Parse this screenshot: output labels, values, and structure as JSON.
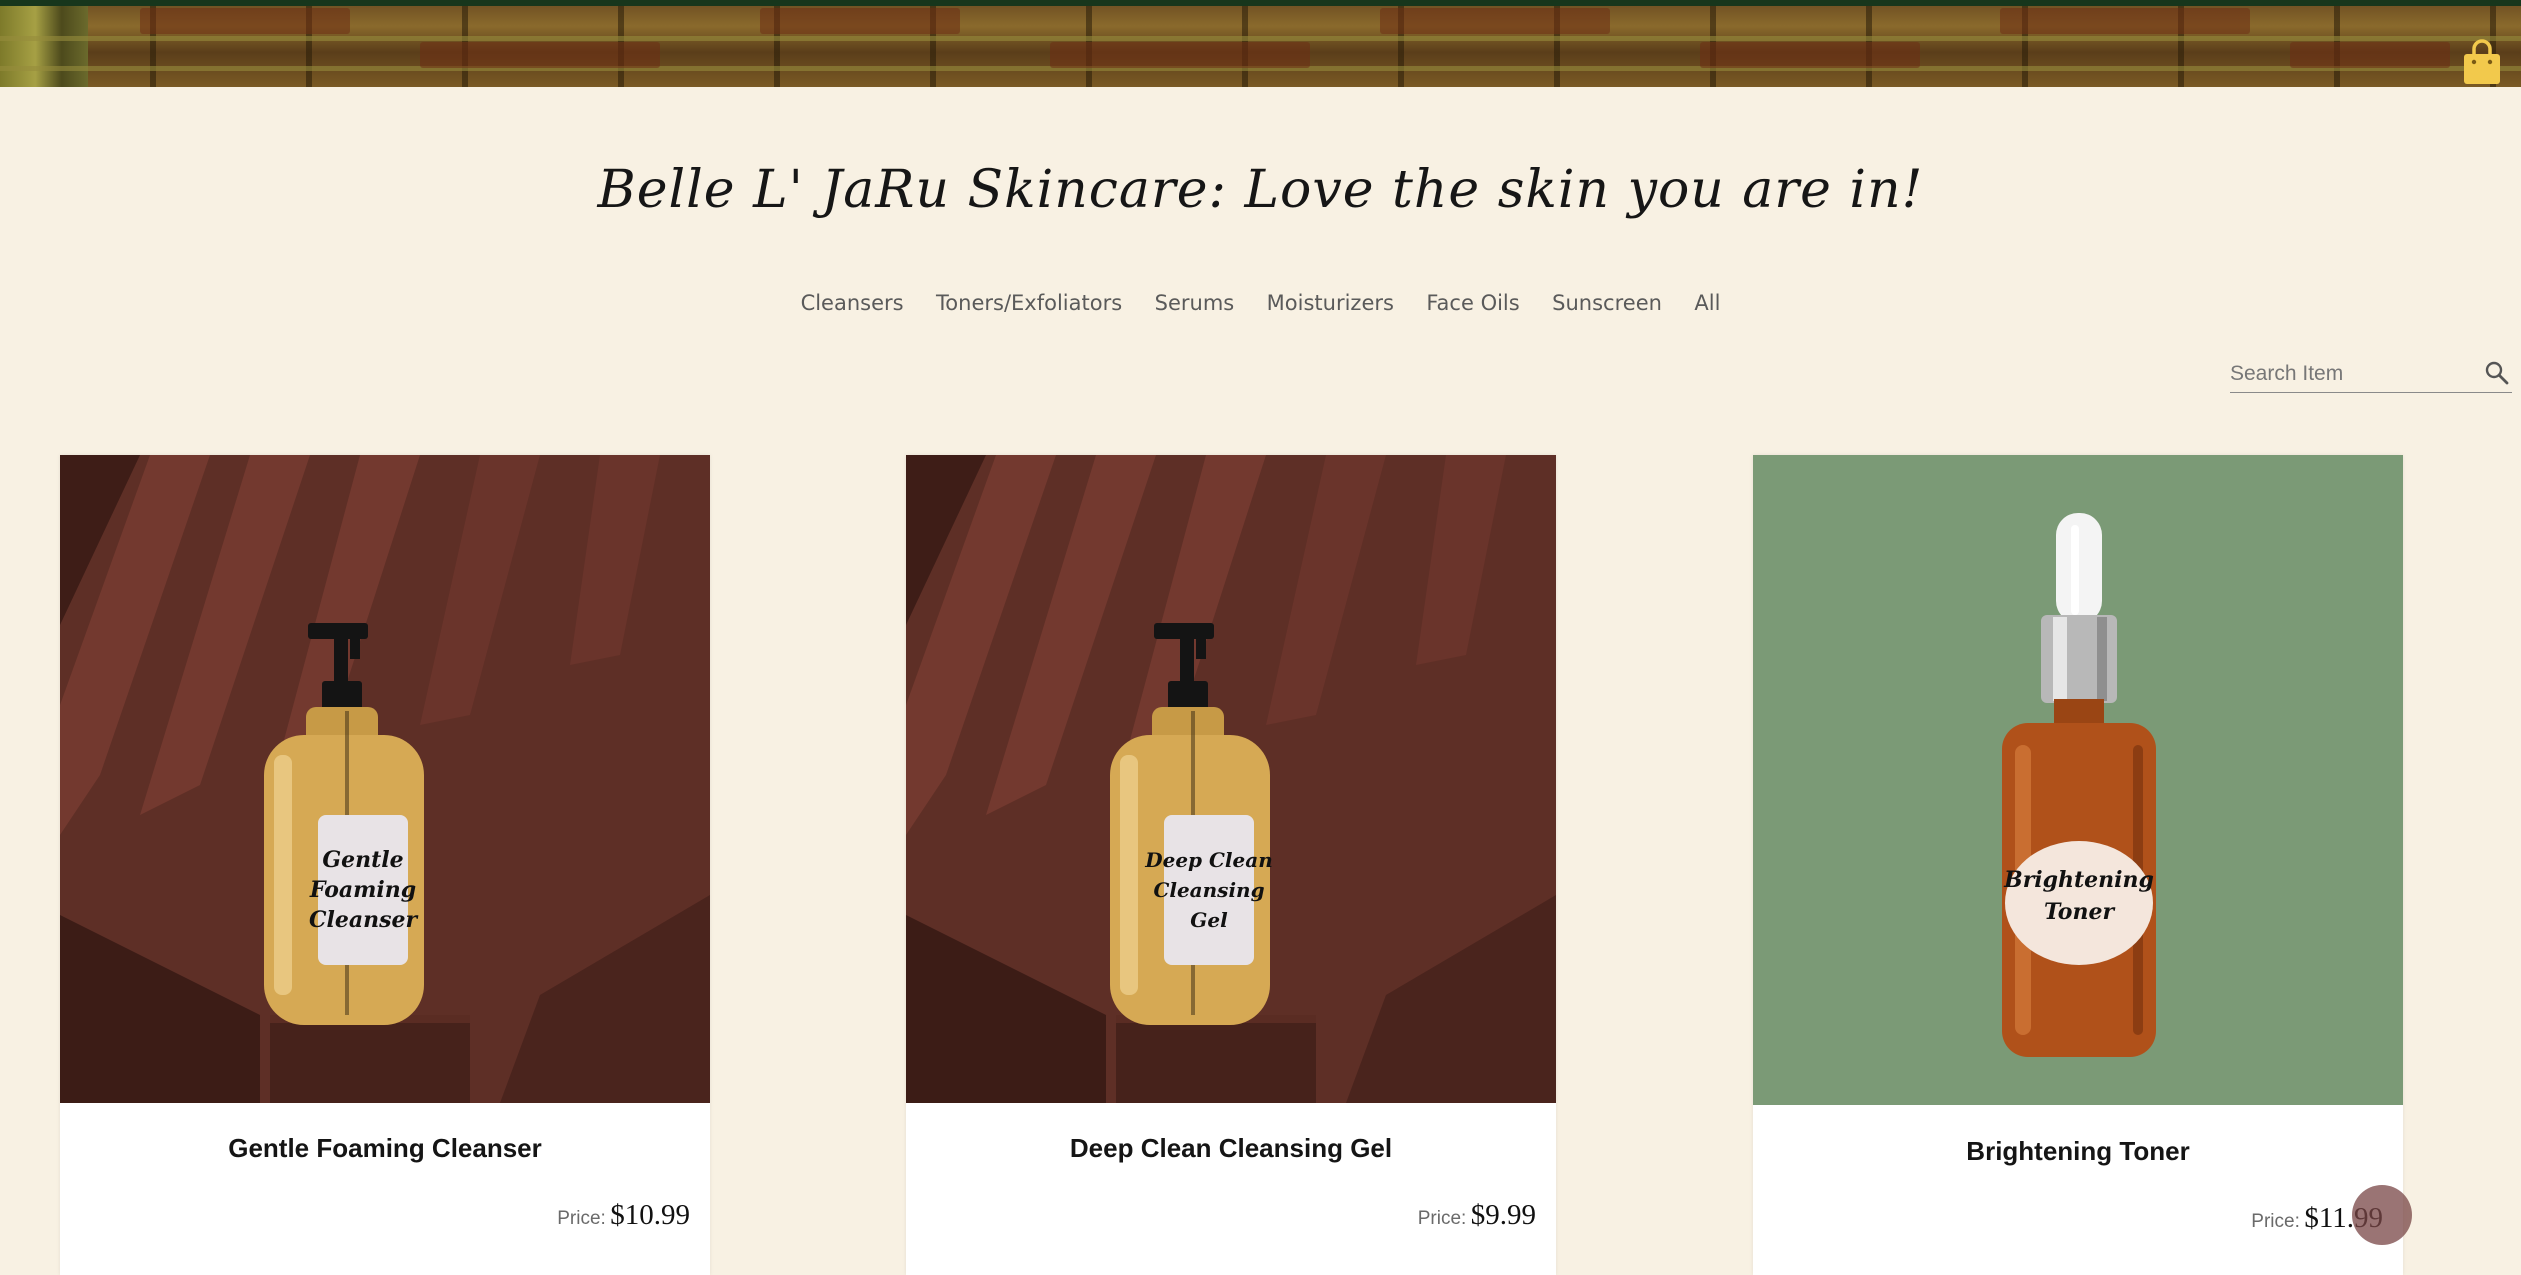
{
  "header": {
    "title": "Belle L' JaRu Skincare: Love the skin you are in!",
    "cart_icon": "shopping-bag-icon"
  },
  "nav": {
    "items": [
      {
        "label": "Cleansers"
      },
      {
        "label": "Toners/Exfoliators"
      },
      {
        "label": "Serums"
      },
      {
        "label": "Moisturizers"
      },
      {
        "label": "Face Oils"
      },
      {
        "label": "Sunscreen"
      },
      {
        "label": "All"
      }
    ]
  },
  "search": {
    "placeholder": "Search Item",
    "value": "",
    "icon": "search-icon"
  },
  "products": [
    {
      "name": "Gentle Foaming Cleanser",
      "price_label": "Price:",
      "price": "$10.99",
      "bottle_label": [
        "Gentle",
        "Foaming",
        "Cleanser"
      ]
    },
    {
      "name": "Deep Clean Cleansing Gel",
      "price_label": "Price:",
      "price": "$9.99",
      "bottle_label": [
        "Deep Clean",
        "Cleansing",
        "Gel"
      ]
    },
    {
      "name": "Brightening Toner",
      "price_label": "Price:",
      "price": "$11.99",
      "bottle_label": [
        "Brightening",
        "Toner"
      ]
    }
  ],
  "colors": {
    "page_background": "#f8f1e3",
    "card_background": "#ffffff",
    "product_backdrop_brown": "#5e2f26",
    "product_backdrop_green": "#7b9a76"
  }
}
